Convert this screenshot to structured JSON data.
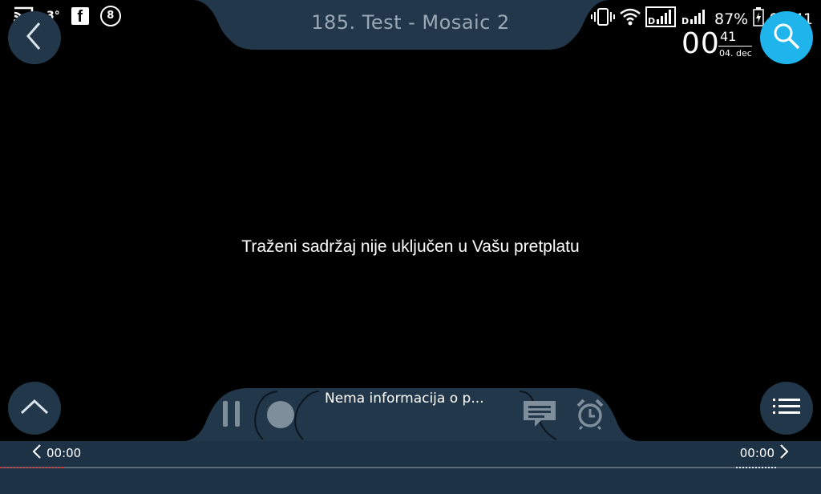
{
  "status_bar": {
    "temperature": "3°",
    "battery_percent": "87%",
    "time": "00:41"
  },
  "header": {
    "title": "185. Test - Mosaic 2"
  },
  "clock": {
    "hour": "00",
    "minute": "41",
    "date": "04. dec"
  },
  "main": {
    "message": "Traženi sadržaj nije uključen u Vašu pretplatu"
  },
  "player": {
    "program_info": "Nema informacija o p...",
    "time_start": "00:00",
    "time_end": "00:00"
  },
  "colors": {
    "panel": "#1e3245",
    "button": "#22374a",
    "search_accent": "#1fb4ec",
    "title_text": "#9aa8b5"
  },
  "icons": [
    "cast-icon",
    "facebook-icon",
    "circle-8-icon",
    "vibrate-icon",
    "wifi-icon",
    "signal-icon",
    "battery-icon",
    "back-icon",
    "search-icon",
    "chevron-up-icon",
    "list-icon",
    "pause-icon",
    "record-icon",
    "chat-icon",
    "alarm-icon",
    "chevron-left-icon",
    "chevron-right-icon"
  ]
}
